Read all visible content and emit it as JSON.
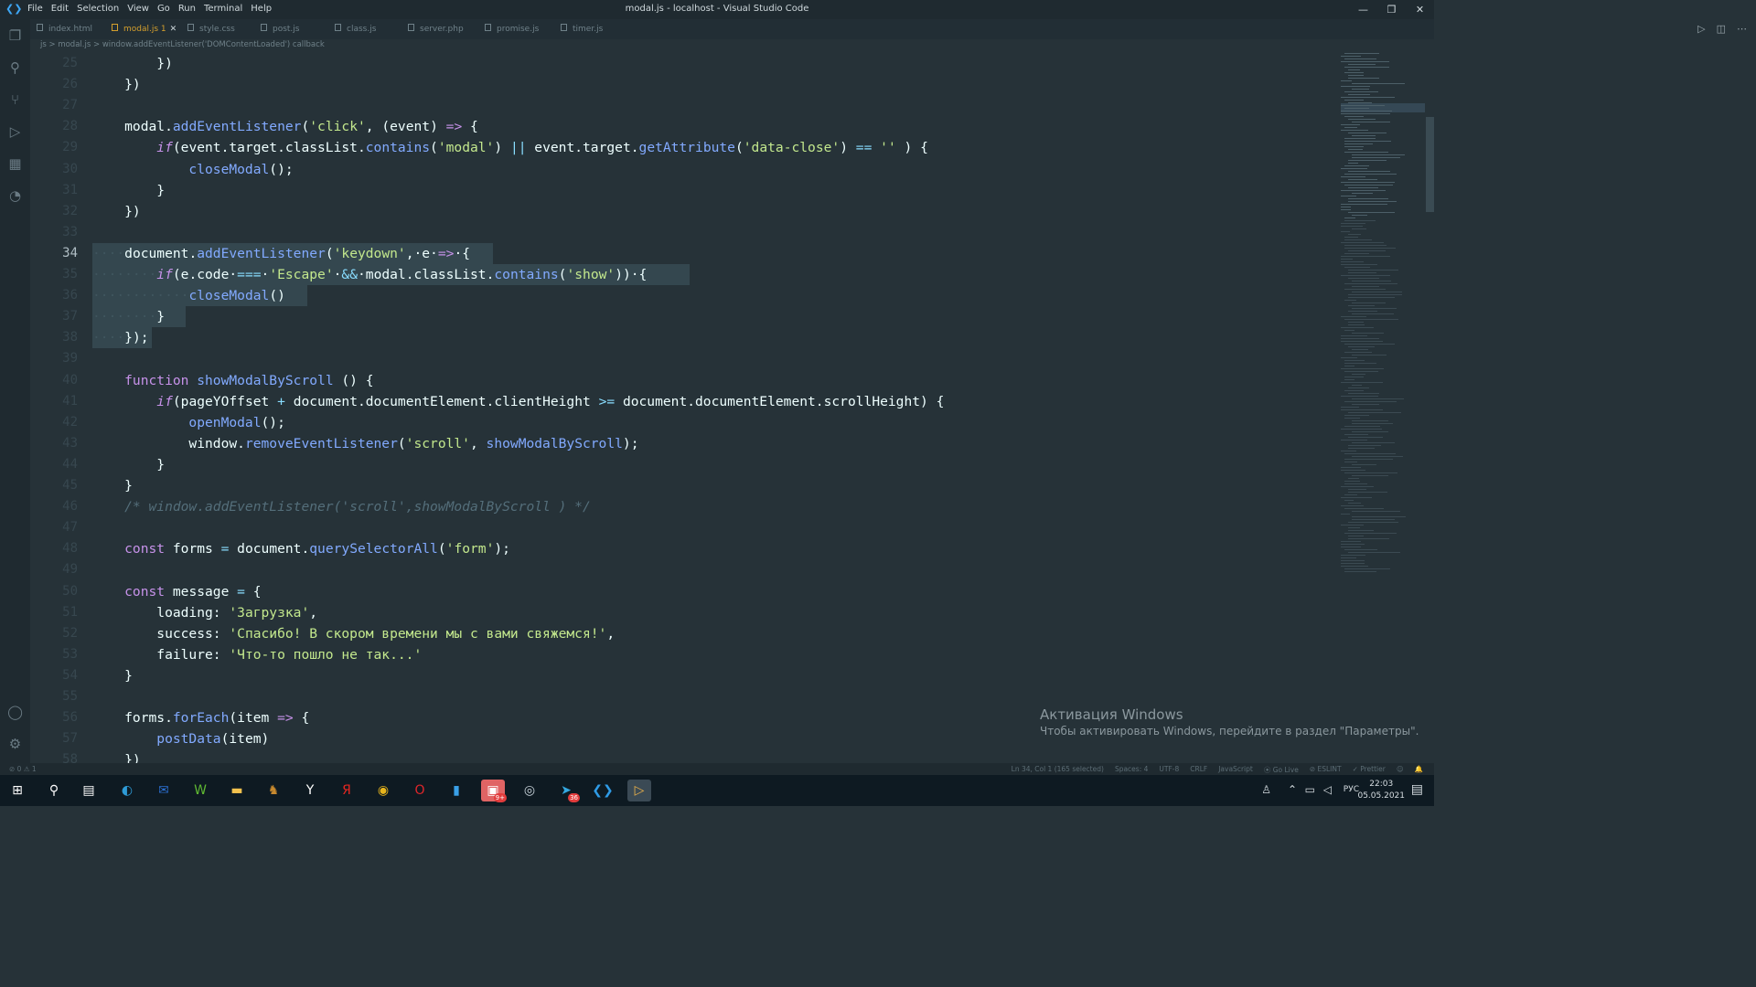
{
  "window": {
    "title": "modal.js - localhost - Visual Studio Code",
    "menu": [
      "File",
      "Edit",
      "Selection",
      "View",
      "Go",
      "Run",
      "Terminal",
      "Help"
    ],
    "controls": [
      "—",
      "❐",
      "✕"
    ]
  },
  "activity_bar": {
    "items": [
      {
        "name": "explorer-icon",
        "glyph": "❐"
      },
      {
        "name": "search-icon",
        "glyph": "⚲"
      },
      {
        "name": "source-control-icon",
        "glyph": "⑂"
      },
      {
        "name": "run-debug-icon",
        "glyph": "▷"
      },
      {
        "name": "extensions-icon",
        "glyph": "▦"
      },
      {
        "name": "git-history-icon",
        "glyph": "◔"
      }
    ],
    "bottom": [
      {
        "name": "account-icon",
        "glyph": "◯"
      },
      {
        "name": "settings-icon",
        "glyph": "⚙"
      }
    ]
  },
  "tabs": [
    {
      "label": "index.html",
      "active": false
    },
    {
      "label": "modal.js 1",
      "active": true
    },
    {
      "label": "style.css",
      "active": false
    },
    {
      "label": "post.js",
      "active": false
    },
    {
      "label": "class.js",
      "active": false
    },
    {
      "label": "server.php",
      "active": false
    },
    {
      "label": "promise.js",
      "active": false
    },
    {
      "label": "timer.js",
      "active": false
    }
  ],
  "tab_close": "✕",
  "editor_actions": [
    "▷",
    "◫",
    "⋯"
  ],
  "breadcrumb": [
    "js",
    "modal.js",
    "window.addEventListener('DOMContentLoaded') callback"
  ],
  "breadcrumb_sep": ">",
  "current_line": 34,
  "code_lines": [
    {
      "n": 25,
      "tokens": [
        [
          "pr",
          "        })"
        ]
      ]
    },
    {
      "n": 26,
      "tokens": [
        [
          "pr",
          "    })"
        ]
      ]
    },
    {
      "n": 27,
      "tokens": []
    },
    {
      "n": 28,
      "tokens": [
        [
          "pr",
          "    modal."
        ],
        [
          "fn",
          "addEventListener"
        ],
        [
          "pr",
          "("
        ],
        [
          "st",
          "'click'"
        ],
        [
          "pr",
          ", (event) "
        ],
        [
          "kw",
          "=>"
        ],
        [
          "pr",
          " {"
        ]
      ]
    },
    {
      "n": 29,
      "tokens": [
        [
          "kw it",
          "        if"
        ],
        [
          "pr",
          "(event.target.classList."
        ],
        [
          "fn",
          "contains"
        ],
        [
          "pr",
          "("
        ],
        [
          "st",
          "'modal'"
        ],
        [
          "pr",
          ") "
        ],
        [
          "op",
          "||"
        ],
        [
          "pr",
          " event.target."
        ],
        [
          "fn",
          "getAttribute"
        ],
        [
          "pr",
          "("
        ],
        [
          "st",
          "'data-close'"
        ],
        [
          "pr",
          ") "
        ],
        [
          "op",
          "=="
        ],
        [
          "pr",
          " "
        ],
        [
          "st",
          "''"
        ],
        [
          "pr",
          " ) {"
        ]
      ]
    },
    {
      "n": 30,
      "tokens": [
        [
          "fn",
          "            closeModal"
        ],
        [
          "pr",
          "();"
        ]
      ]
    },
    {
      "n": 31,
      "tokens": [
        [
          "pr",
          "        }"
        ]
      ]
    },
    {
      "n": 32,
      "tokens": [
        [
          "pr",
          "    })"
        ]
      ]
    },
    {
      "n": 33,
      "tokens": []
    },
    {
      "n": 34,
      "tokens": [
        [
          "ws",
          "····"
        ],
        [
          "pr",
          "document."
        ],
        [
          "fn",
          "addEventListener"
        ],
        [
          "pr",
          "("
        ],
        [
          "st",
          "'keydown'"
        ],
        [
          "pr",
          ",·e·"
        ],
        [
          "kw",
          "=>"
        ],
        [
          "pr",
          "·{"
        ]
      ]
    },
    {
      "n": 35,
      "tokens": [
        [
          "ws",
          "········"
        ],
        [
          "kw it",
          "if"
        ],
        [
          "pr",
          "(e.code·"
        ],
        [
          "op",
          "==="
        ],
        [
          "pr",
          "·"
        ],
        [
          "st",
          "'Escape'"
        ],
        [
          "pr",
          "·"
        ],
        [
          "op",
          "&&"
        ],
        [
          "pr",
          "·modal.classList."
        ],
        [
          "fn",
          "contains"
        ],
        [
          "pr",
          "("
        ],
        [
          "st",
          "'show'"
        ],
        [
          "pr",
          "))·{"
        ]
      ]
    },
    {
      "n": 36,
      "tokens": [
        [
          "ws",
          "············"
        ],
        [
          "fn",
          "closeModal"
        ],
        [
          "pr",
          "()"
        ]
      ]
    },
    {
      "n": 37,
      "tokens": [
        [
          "ws",
          "········"
        ],
        [
          "pr",
          "}"
        ]
      ]
    },
    {
      "n": 38,
      "tokens": [
        [
          "ws",
          "····"
        ],
        [
          "pr",
          "});"
        ]
      ]
    },
    {
      "n": 39,
      "tokens": []
    },
    {
      "n": 40,
      "tokens": [
        [
          "kw",
          "    function "
        ],
        [
          "fn",
          "showModalByScroll"
        ],
        [
          "pr",
          " () {"
        ]
      ]
    },
    {
      "n": 41,
      "tokens": [
        [
          "kw it",
          "        if"
        ],
        [
          "pr",
          "(pageYOffset "
        ],
        [
          "op",
          "+"
        ],
        [
          "pr",
          " document.documentElement.clientHeight "
        ],
        [
          "op",
          ">="
        ],
        [
          "pr",
          " document.documentElement.scrollHeight) {"
        ]
      ]
    },
    {
      "n": 42,
      "tokens": [
        [
          "fn",
          "            openModal"
        ],
        [
          "pr",
          "();"
        ]
      ]
    },
    {
      "n": 43,
      "tokens": [
        [
          "pr",
          "            window."
        ],
        [
          "fn",
          "removeEventListener"
        ],
        [
          "pr",
          "("
        ],
        [
          "st",
          "'scroll'"
        ],
        [
          "pr",
          ", "
        ],
        [
          "fn",
          "showModalByScroll"
        ],
        [
          "pr",
          ");"
        ]
      ]
    },
    {
      "n": 44,
      "tokens": [
        [
          "pr",
          "        }"
        ]
      ]
    },
    {
      "n": 45,
      "tokens": [
        [
          "pr",
          "    }"
        ]
      ]
    },
    {
      "n": 46,
      "tokens": [
        [
          "cm",
          "    /* window.addEventListener('scroll',showModalByScroll ) */"
        ]
      ]
    },
    {
      "n": 47,
      "tokens": []
    },
    {
      "n": 48,
      "tokens": [
        [
          "kw",
          "    const "
        ],
        [
          "pr",
          "forms "
        ],
        [
          "op",
          "="
        ],
        [
          "pr",
          " document."
        ],
        [
          "fn",
          "querySelectorAll"
        ],
        [
          "pr",
          "("
        ],
        [
          "st",
          "'form'"
        ],
        [
          "pr",
          ");"
        ]
      ]
    },
    {
      "n": 49,
      "tokens": []
    },
    {
      "n": 50,
      "tokens": [
        [
          "kw",
          "    const "
        ],
        [
          "pr",
          "message "
        ],
        [
          "op",
          "="
        ],
        [
          "pr",
          " {"
        ]
      ]
    },
    {
      "n": 51,
      "tokens": [
        [
          "pr",
          "        loading: "
        ],
        [
          "st",
          "'Загрузка'"
        ],
        [
          "pr",
          ","
        ]
      ]
    },
    {
      "n": 52,
      "tokens": [
        [
          "pr",
          "        success: "
        ],
        [
          "st",
          "'Спасибо! В скором времени мы с вами свяжемся!'"
        ],
        [
          "pr",
          ","
        ]
      ]
    },
    {
      "n": 53,
      "tokens": [
        [
          "pr",
          "        failure: "
        ],
        [
          "st",
          "'Что-то пошло не так...'"
        ]
      ]
    },
    {
      "n": 54,
      "tokens": [
        [
          "pr",
          "    }"
        ]
      ]
    },
    {
      "n": 55,
      "tokens": []
    },
    {
      "n": 56,
      "tokens": [
        [
          "pr",
          "    forms."
        ],
        [
          "fn",
          "forEach"
        ],
        [
          "pr",
          "(item "
        ],
        [
          "kw",
          "=>"
        ],
        [
          "pr",
          " {"
        ]
      ]
    },
    {
      "n": 57,
      "tokens": [
        [
          "fn",
          "        postData"
        ],
        [
          "pr",
          "(item)"
        ]
      ]
    },
    {
      "n": 58,
      "tokens": [
        [
          "pr",
          "    })"
        ]
      ]
    }
  ],
  "activation": {
    "title": "Активация Windows",
    "subtitle": "Чтобы активировать Windows, перейдите в раздел \"Параметры\"."
  },
  "status_bar": {
    "problems": "⊘ 0 ⚠ 1",
    "position": "Ln 34, Col 1 (165 selected)",
    "spaces": "Spaces: 4",
    "encoding": "UTF-8",
    "eol": "CRLF",
    "language": "JavaScript",
    "go_live": "⦿ Go Live",
    "eslint": "⊘ ESLINT",
    "prettier": "✓ Prettier"
  },
  "taskbar": {
    "apps": [
      {
        "name": "start-icon",
        "glyph": "⊞",
        "color": "#ffffff"
      },
      {
        "name": "taskbar-search-icon",
        "glyph": "⚲",
        "color": "#ffffff"
      },
      {
        "name": "task-view-icon",
        "glyph": "▤",
        "color": "#ffffff"
      },
      {
        "name": "edge-icon",
        "glyph": "◐",
        "color": "#2e9bd6"
      },
      {
        "name": "mail-icon",
        "glyph": "✉",
        "color": "#2b6ecf"
      },
      {
        "name": "wechat-like-icon",
        "glyph": "W",
        "color": "#5fb832"
      },
      {
        "name": "file-explorer-icon",
        "glyph": "▬",
        "color": "#f2c14e"
      },
      {
        "name": "app-icon",
        "glyph": "♞",
        "color": "#c98a2e"
      },
      {
        "name": "yandex-browser-icon",
        "glyph": "Y",
        "color": "#ffffff"
      },
      {
        "name": "yandex-icon",
        "glyph": "Я",
        "color": "#e52620"
      },
      {
        "name": "chrome-icon",
        "glyph": "◉",
        "color": "#e8b51c"
      },
      {
        "name": "opera-icon",
        "glyph": "O",
        "color": "#e0262b"
      },
      {
        "name": "phone-icon",
        "glyph": "▮",
        "color": "#3aa0e8"
      },
      {
        "name": "games-icon",
        "glyph": "▣",
        "color": "#e75a6a"
      },
      {
        "name": "steam-icon",
        "glyph": "◎",
        "color": "#c8d3da"
      },
      {
        "name": "telegram-icon",
        "glyph": "➤",
        "color": "#34a8e0"
      },
      {
        "name": "vscode-icon",
        "glyph": "❮❯",
        "color": "#2f9be6"
      },
      {
        "name": "player-icon",
        "glyph": "▷",
        "color": "#f0b449"
      }
    ],
    "badges": {
      "games-icon": "9+",
      "telegram-icon": "36"
    },
    "tray": {
      "lang": "РУС",
      "time": "22:03",
      "date": "05.05.2021"
    }
  }
}
